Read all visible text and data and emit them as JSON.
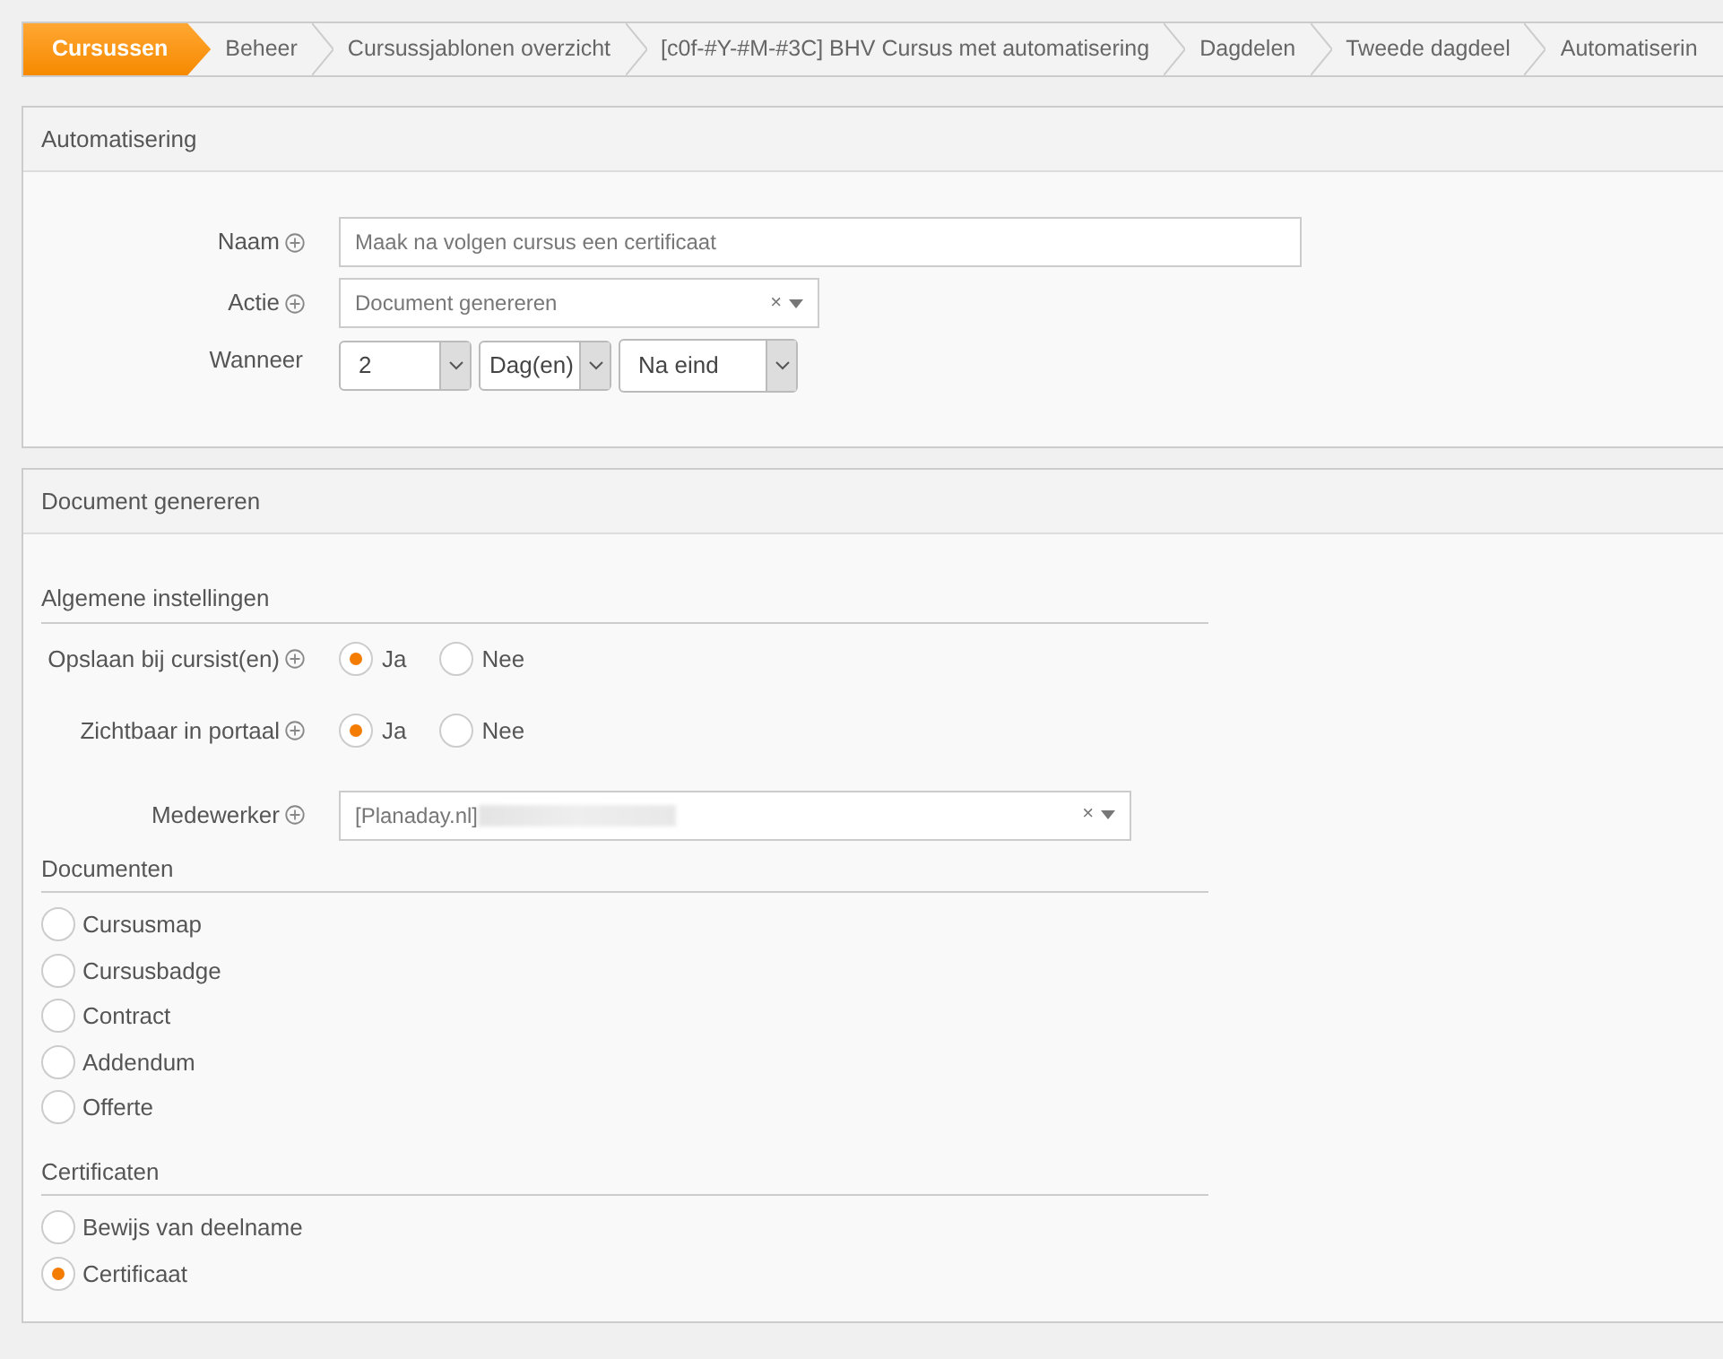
{
  "breadcrumb": [
    {
      "label": "Cursussen",
      "selected": true
    },
    {
      "label": "Beheer",
      "selected": false
    },
    {
      "label": "Cursussjablonen overzicht",
      "selected": false
    },
    {
      "label": "[c0f-#Y-#M-#3C] BHV Cursus met automatisering",
      "selected": false
    },
    {
      "label": "Dagdelen",
      "selected": false
    },
    {
      "label": "Tweede dagdeel",
      "selected": false
    },
    {
      "label": "Automatiserin",
      "selected": false
    }
  ],
  "automation_panel": {
    "title": "Automatisering",
    "naam": {
      "label": "Naam",
      "value": "Maak na volgen cursus een certificaat"
    },
    "actie": {
      "label": "Actie",
      "value": "Document genereren",
      "clear": "×"
    },
    "wanneer": {
      "label": "Wanneer",
      "selects": [
        "2",
        "Dag(en)",
        "Na eind"
      ]
    }
  },
  "document_panel": {
    "title": "Document genereren",
    "general": {
      "heading": "Algemene instellingen",
      "options": [
        {
          "label": "Opslaan bij cursist(en)",
          "choices": [
            {
              "label": "Ja",
              "selected": true
            },
            {
              "label": "Nee",
              "selected": false
            }
          ]
        },
        {
          "label": "Zichtbaar in portaal",
          "choices": [
            {
              "label": "Ja",
              "selected": true
            },
            {
              "label": "Nee",
              "selected": false
            }
          ]
        }
      ],
      "medewerker": {
        "label": "Medewerker",
        "value": "[Planaday.nl]",
        "clear": "×"
      }
    },
    "groups": [
      {
        "heading": "Documenten",
        "items": [
          {
            "label": "Cursusmap",
            "selected": false
          },
          {
            "label": "Cursusbadge",
            "selected": false
          },
          {
            "label": "Contract",
            "selected": false
          },
          {
            "label": "Addendum",
            "selected": false
          },
          {
            "label": "Offerte",
            "selected": false
          }
        ]
      },
      {
        "heading": "Certificaten",
        "items": [
          {
            "label": "Bewijs van deelname",
            "selected": false
          },
          {
            "label": "Certificaat",
            "selected": true
          }
        ]
      }
    ]
  }
}
